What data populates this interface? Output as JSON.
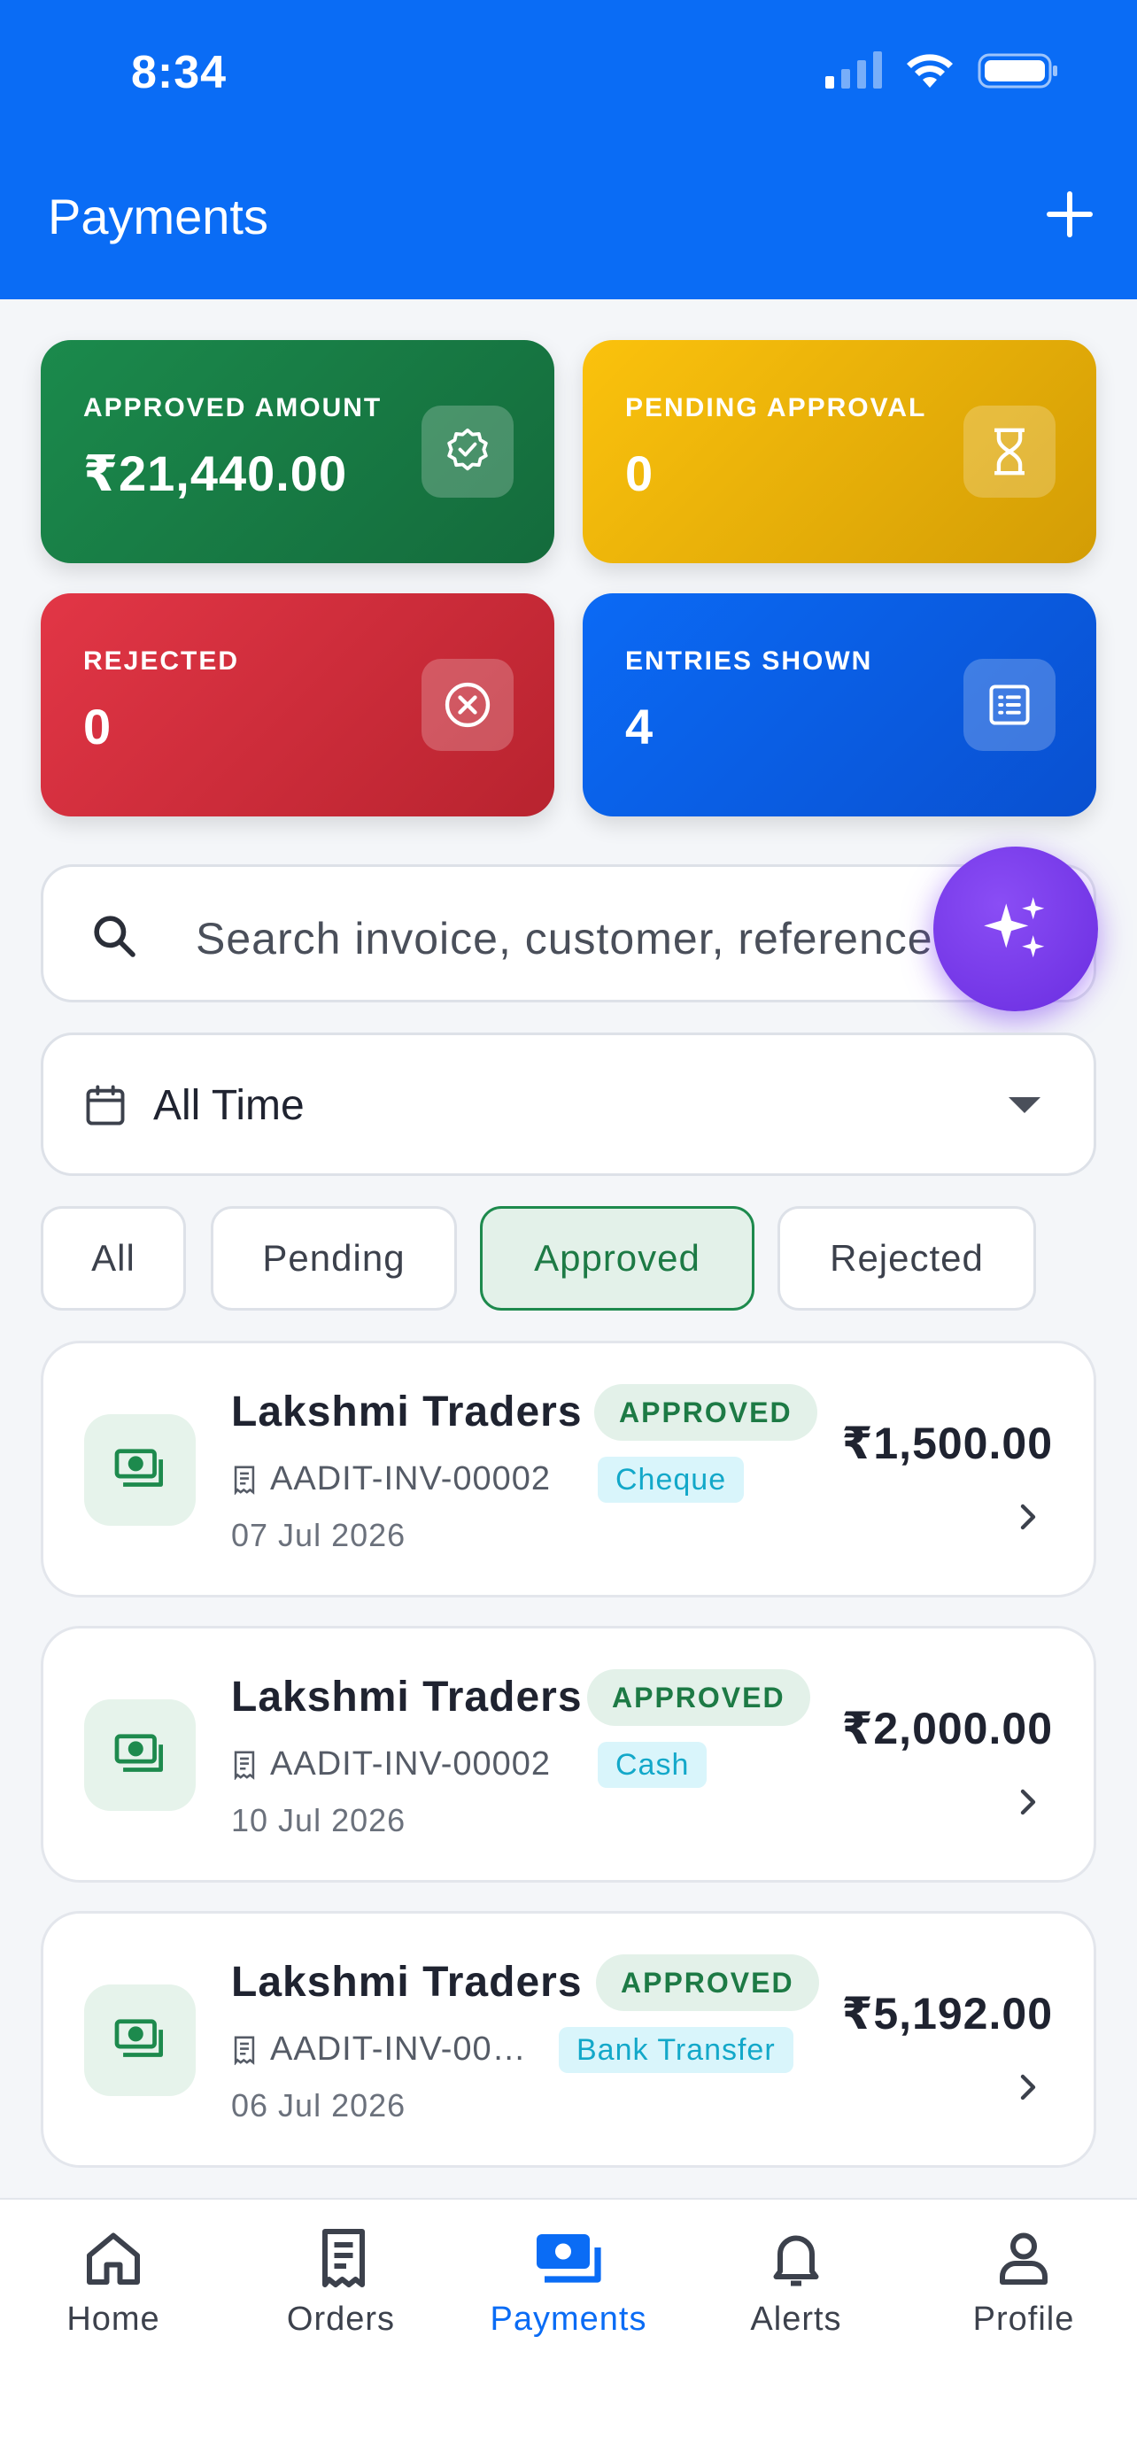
{
  "status_bar": {
    "time": "8:34"
  },
  "header": {
    "title": "Payments"
  },
  "stats": [
    {
      "label": "APPROVED AMOUNT",
      "value": "₹21,440.00",
      "icon": "verified-badge-icon"
    },
    {
      "label": "PENDING APPROVAL",
      "value": "0",
      "icon": "hourglass-icon"
    },
    {
      "label": "REJECTED",
      "value": "0",
      "icon": "x-circle-icon"
    },
    {
      "label": "ENTRIES SHOWN",
      "value": "4",
      "icon": "list-icon"
    }
  ],
  "search": {
    "placeholder": "Search invoice, customer, reference"
  },
  "date_filter": {
    "selected": "All Time"
  },
  "filters": [
    {
      "label": "All",
      "active": false
    },
    {
      "label": "Pending",
      "active": false
    },
    {
      "label": "Approved",
      "active": true
    },
    {
      "label": "Rejected",
      "active": false
    }
  ],
  "payments": [
    {
      "customer": "Lakshmi Traders",
      "status": "APPROVED",
      "invoice": "AADIT-INV-00002",
      "method": "Cheque",
      "date": "07 Jul 2026",
      "amount": "₹1,500.00"
    },
    {
      "customer": "Lakshmi Traders",
      "status": "APPROVED",
      "invoice": "AADIT-INV-00002",
      "method": "Cash",
      "date": "10 Jul 2026",
      "amount": "₹2,000.00"
    },
    {
      "customer": "Lakshmi Traders",
      "status": "APPROVED",
      "invoice": "AADIT-INV-00…",
      "method": "Bank Transfer",
      "date": "06 Jul 2026",
      "amount": "₹5,192.00"
    }
  ],
  "tabs": [
    {
      "label": "Home",
      "icon": "home-icon",
      "active": false
    },
    {
      "label": "Orders",
      "icon": "receipt-icon",
      "active": false
    },
    {
      "label": "Payments",
      "icon": "money-icon",
      "active": true
    },
    {
      "label": "Alerts",
      "icon": "bell-icon",
      "active": false
    },
    {
      "label": "Profile",
      "icon": "user-icon",
      "active": false
    }
  ],
  "colors": {
    "primary": "#0a6cf5",
    "approved": "#1b8a4c",
    "pending": "#fbc20d",
    "rejected": "#e23646",
    "ai": "#7a3cf0"
  }
}
